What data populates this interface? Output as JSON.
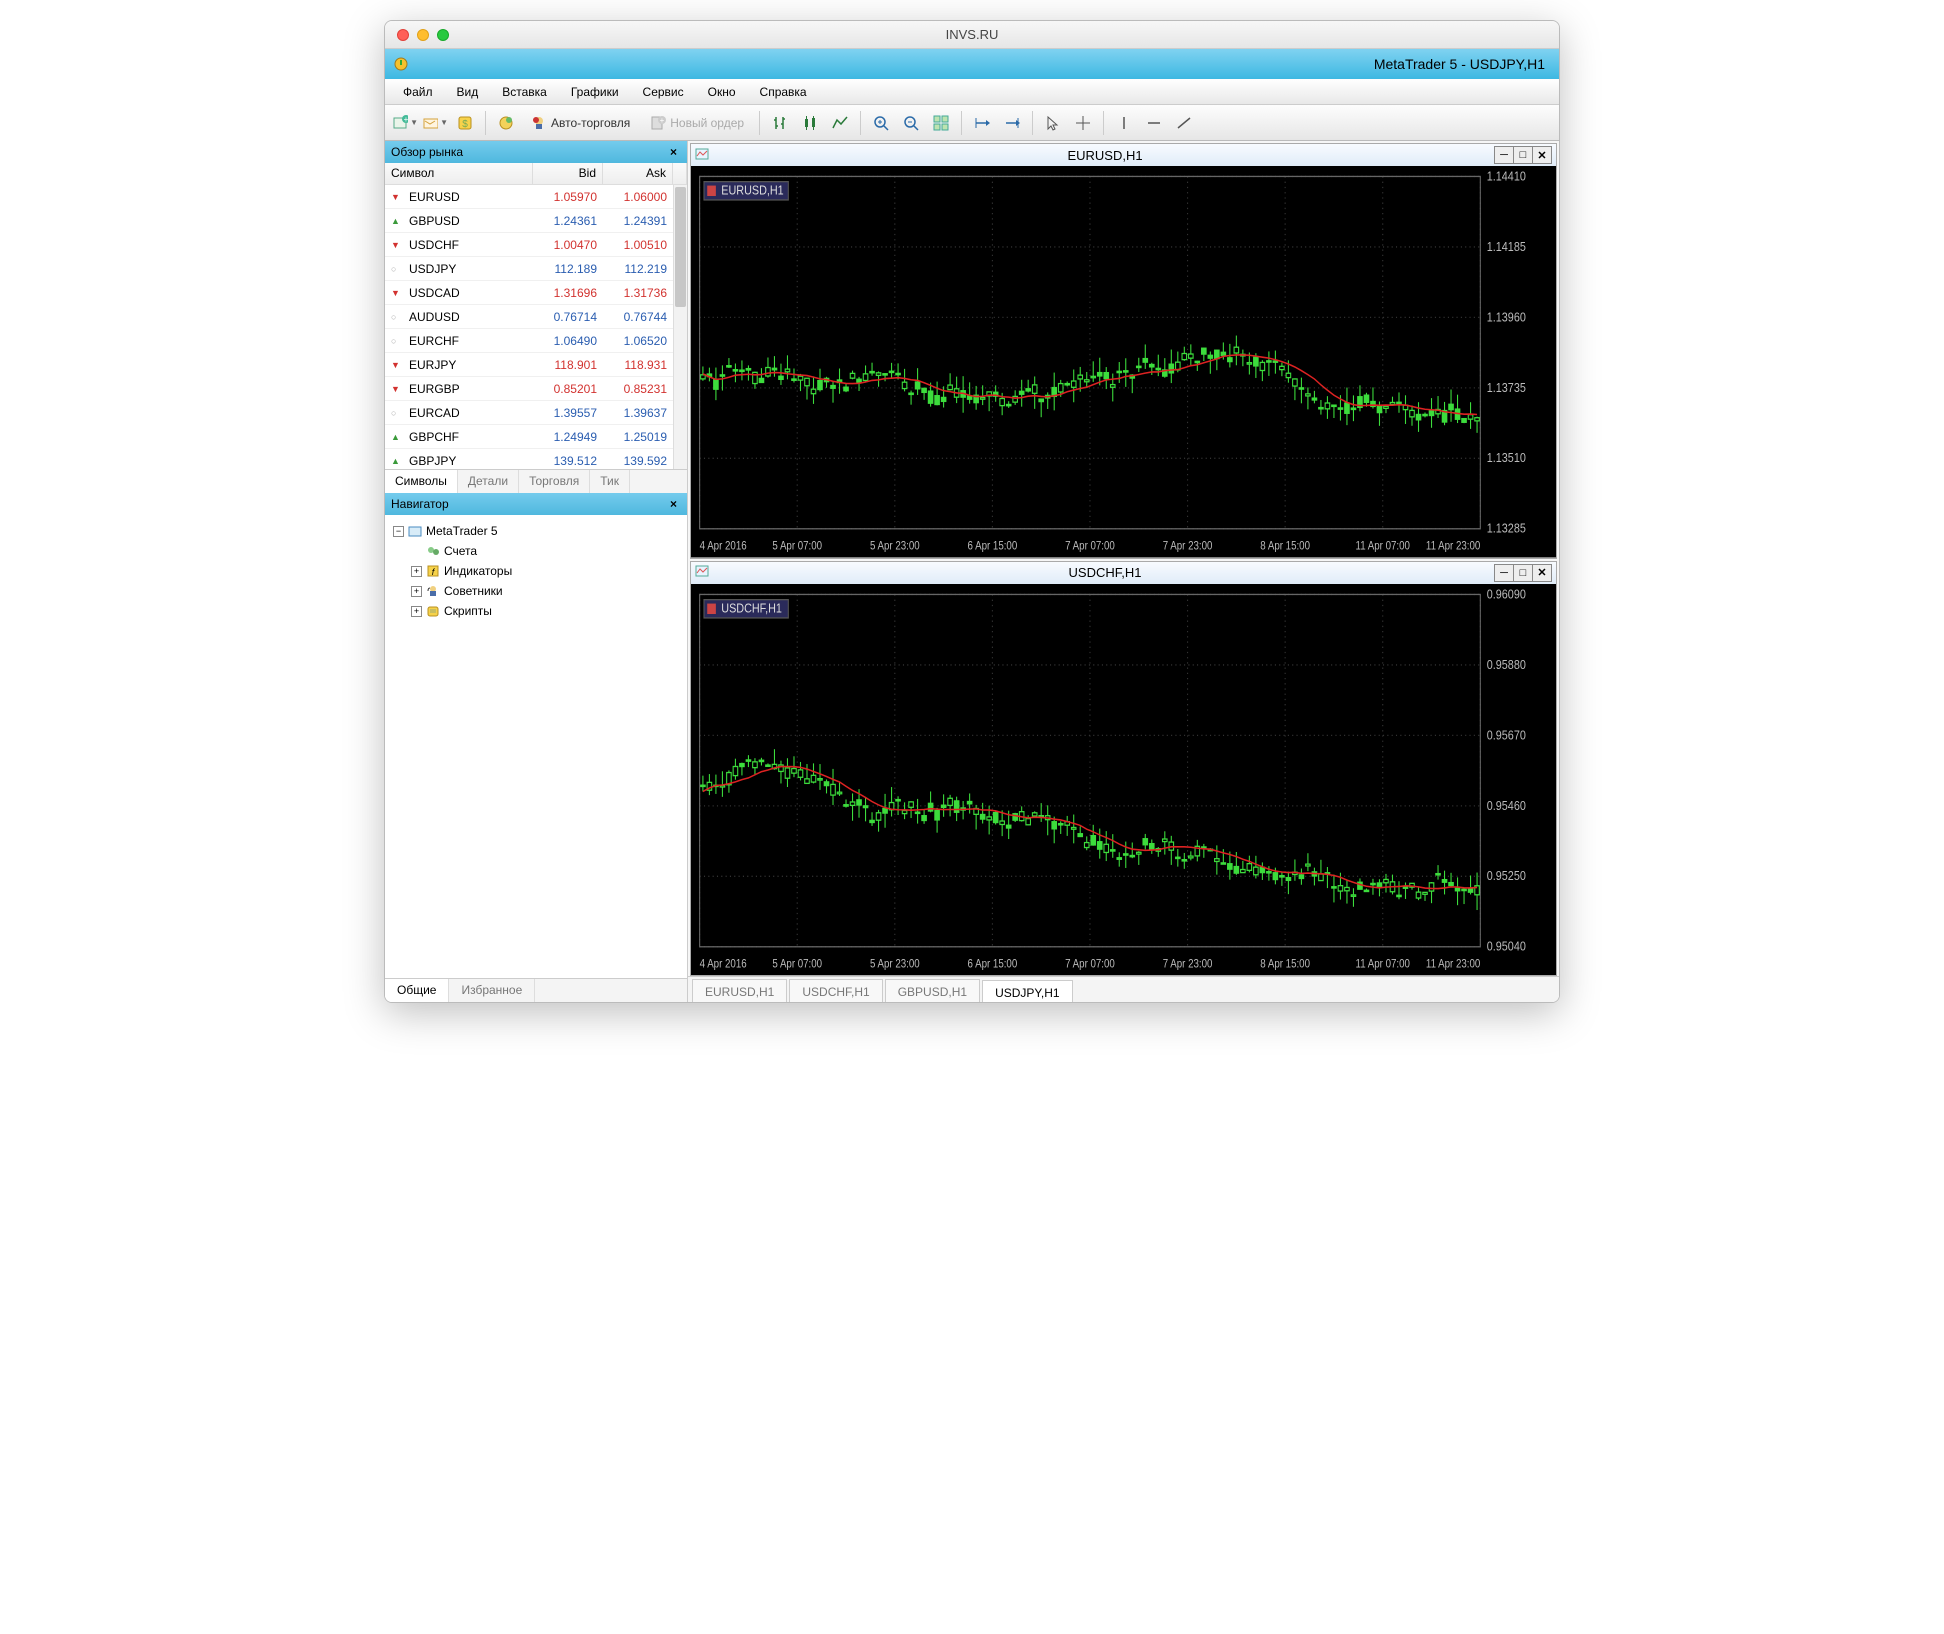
{
  "mac_title": "INVS.RU",
  "app_title": "MetaTrader 5 - USDJPY,H1",
  "menu": [
    "Файл",
    "Вид",
    "Вставка",
    "Графики",
    "Сервис",
    "Окно",
    "Справка"
  ],
  "toolbar": {
    "autotrade": "Авто-торговля",
    "neworder": "Новый ордер"
  },
  "market": {
    "title": "Обзор рынка",
    "cols": {
      "symbol": "Символ",
      "bid": "Bid",
      "ask": "Ask"
    },
    "tabs": [
      "Символы",
      "Детали",
      "Торговля",
      "Тик"
    ],
    "rows": [
      {
        "sym": "EURUSD",
        "bid": "1.05970",
        "ask": "1.06000",
        "color": "red",
        "arrow": "down"
      },
      {
        "sym": "GBPUSD",
        "bid": "1.24361",
        "ask": "1.24391",
        "color": "blue",
        "arrow": "up"
      },
      {
        "sym": "USDCHF",
        "bid": "1.00470",
        "ask": "1.00510",
        "color": "red",
        "arrow": "down"
      },
      {
        "sym": "USDJPY",
        "bid": "112.189",
        "ask": "112.219",
        "color": "blue",
        "arrow": "none"
      },
      {
        "sym": "USDCAD",
        "bid": "1.31696",
        "ask": "1.31736",
        "color": "red",
        "arrow": "down"
      },
      {
        "sym": "AUDUSD",
        "bid": "0.76714",
        "ask": "0.76744",
        "color": "blue",
        "arrow": "none"
      },
      {
        "sym": "EURCHF",
        "bid": "1.06490",
        "ask": "1.06520",
        "color": "blue",
        "arrow": "none"
      },
      {
        "sym": "EURJPY",
        "bid": "118.901",
        "ask": "118.931",
        "color": "red",
        "arrow": "down"
      },
      {
        "sym": "EURGBP",
        "bid": "0.85201",
        "ask": "0.85231",
        "color": "red",
        "arrow": "down"
      },
      {
        "sym": "EURCAD",
        "bid": "1.39557",
        "ask": "1.39637",
        "color": "blue",
        "arrow": "none"
      },
      {
        "sym": "GBPCHF",
        "bid": "1.24949",
        "ask": "1.25019",
        "color": "blue",
        "arrow": "up"
      },
      {
        "sym": "GBPJPY",
        "bid": "139.512",
        "ask": "139.592",
        "color": "blue",
        "arrow": "up"
      }
    ]
  },
  "navigator": {
    "title": "Навигатор",
    "root": "MetaTrader 5",
    "items": [
      {
        "label": "Счета",
        "exp": ""
      },
      {
        "label": "Индикаторы",
        "exp": "+"
      },
      {
        "label": "Советники",
        "exp": "+"
      },
      {
        "label": "Скрипты",
        "exp": "+"
      }
    ],
    "tabs": [
      "Общие",
      "Избранное"
    ]
  },
  "charts": {
    "windows": [
      {
        "title": "EURUSD,H1",
        "label": "EURUSD,H1",
        "yticks": [
          "1.14410",
          "1.14185",
          "1.13960",
          "1.13735",
          "1.13510",
          "1.13285"
        ]
      },
      {
        "title": "USDCHF,H1",
        "label": "USDCHF,H1",
        "yticks": [
          "0.96090",
          "0.95880",
          "0.95670",
          "0.95460",
          "0.95250",
          "0.95040"
        ]
      }
    ],
    "xlabels": [
      "4 Apr 2016",
      "5 Apr 07:00",
      "5 Apr 23:00",
      "6 Apr 15:00",
      "7 Apr 07:00",
      "7 Apr 23:00",
      "8 Apr 15:00",
      "11 Apr 07:00",
      "11 Apr 23:00"
    ],
    "tabs": [
      "EURUSD,H1",
      "USDCHF,H1",
      "GBPUSD,H1",
      "USDJPY,H1"
    ],
    "active_tab": 3
  },
  "chart_data": [
    {
      "type": "candlestick",
      "title": "EURUSD,H1",
      "ylim": [
        1.1306,
        1.1452
      ],
      "indicator": "moving-average"
    },
    {
      "type": "candlestick",
      "title": "USDCHF,H1",
      "ylim": [
        0.9483,
        0.963
      ],
      "indicator": "moving-average"
    }
  ]
}
